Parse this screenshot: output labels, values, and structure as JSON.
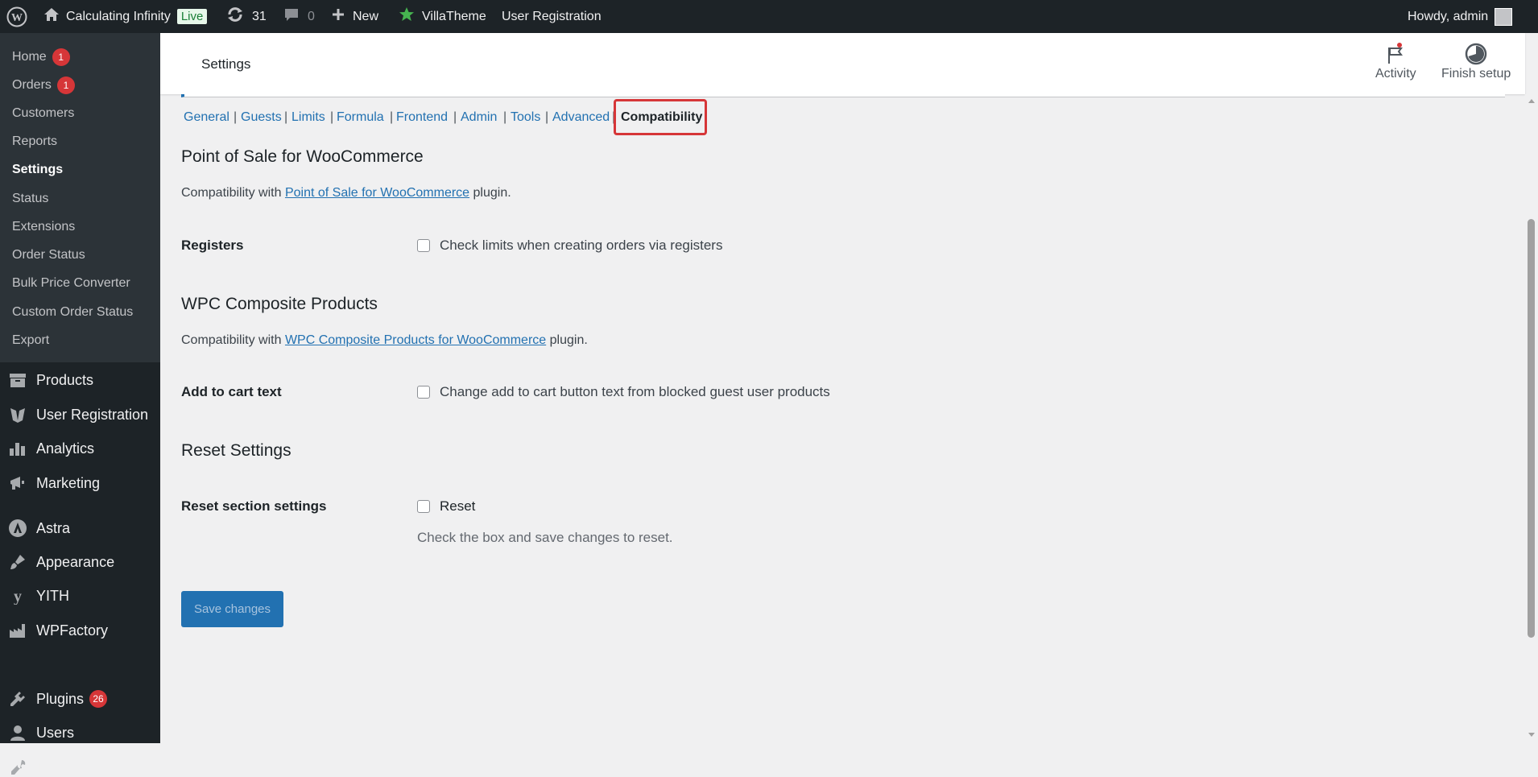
{
  "adminbar": {
    "site_name": "Calculating Infinity",
    "live_label": "Live",
    "updates_count": "31",
    "comments_count": "0",
    "new_label": "New",
    "villatheme_label": "VillaTheme",
    "user_registration_label": "User Registration",
    "howdy_label": "Howdy, admin"
  },
  "sidebar": {
    "submenu": [
      {
        "label": "Home",
        "badge": "1"
      },
      {
        "label": "Orders",
        "badge": "1"
      },
      {
        "label": "Customers"
      },
      {
        "label": "Reports"
      },
      {
        "label": "Settings"
      },
      {
        "label": "Status"
      },
      {
        "label": "Extensions"
      },
      {
        "label": "Order Status"
      },
      {
        "label": "Bulk Price Converter"
      },
      {
        "label": "Custom Order Status"
      },
      {
        "label": "Export"
      }
    ],
    "menu": [
      {
        "label": "Products",
        "icon": "products-icon"
      },
      {
        "label": "User Registration",
        "icon": "user-registration-icon"
      },
      {
        "label": "Analytics",
        "icon": "analytics-icon"
      },
      {
        "label": "Marketing",
        "icon": "marketing-icon"
      },
      {
        "label": "Astra",
        "icon": "astra-icon"
      },
      {
        "label": "Appearance",
        "icon": "appearance-icon"
      },
      {
        "label": "YITH",
        "icon": "yith-icon"
      },
      {
        "label": "WPFactory",
        "icon": "wpfactory-icon"
      },
      {
        "label": "Plugins",
        "icon": "plugins-icon",
        "badge": "26"
      },
      {
        "label": "Users",
        "icon": "users-icon"
      },
      {
        "label": "Tools",
        "icon": "tools-icon"
      }
    ]
  },
  "header": {
    "title": "Settings",
    "activity_label": "Activity",
    "finish_setup_label": "Finish setup"
  },
  "tabs": [
    "General",
    "Guests",
    "Limits",
    "Formula",
    "Frontend",
    "Admin",
    "Tools",
    "Advanced",
    "Compatibility"
  ],
  "sections": {
    "pos": {
      "title": "Point of Sale for WooCommerce",
      "desc_prefix": "Compatibility with ",
      "desc_link": "Point of Sale for WooCommerce",
      "desc_suffix": " plugin.",
      "field_label": "Registers",
      "checkbox_label": "Check limits when creating orders via registers"
    },
    "wpc": {
      "title": "WPC Composite Products",
      "desc_prefix": "Compatibility with ",
      "desc_link": "WPC Composite Products for WooCommerce",
      "desc_suffix": " plugin.",
      "field_label": "Add to cart text",
      "checkbox_label": "Change add to cart button text from blocked guest user products"
    },
    "reset": {
      "title": "Reset Settings",
      "field_label": "Reset section settings",
      "checkbox_label": "Reset",
      "help": "Check the box and save changes to reset."
    }
  },
  "save_button": "Save changes"
}
